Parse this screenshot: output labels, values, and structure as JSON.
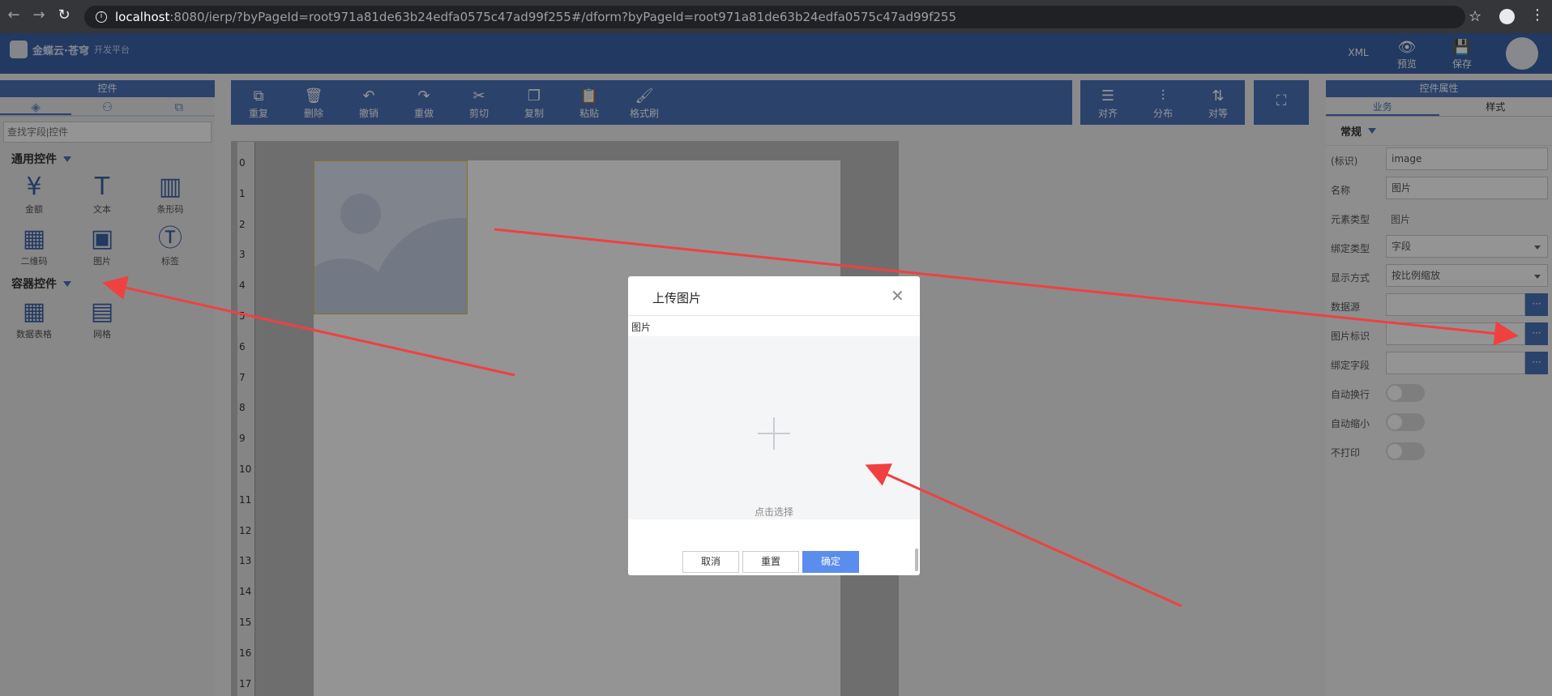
{
  "browser": {
    "url_host": "localhost",
    "url_rest": ":8080/ierp/?byPageId=root971a81de63b24edfa0575c47ad99f255#/dform?byPageId=root971a81de63b24edfa0575c47ad99f255"
  },
  "header": {
    "logo_text": "金蝶云·苍穹",
    "logo_sub": "开发平台",
    "xml_label": "XML",
    "preview_label": "预览",
    "save_label": "保存"
  },
  "left_panel": {
    "title": "控件",
    "search_placeholder": "查找字段|控件",
    "group_common": "通用控件",
    "common_controls": [
      {
        "label": "金额",
        "icon": "yen-icon",
        "glyph": "¥"
      },
      {
        "label": "文本",
        "icon": "text-icon",
        "glyph": "T"
      },
      {
        "label": "条形码",
        "icon": "barcode-icon",
        "glyph": "▥"
      },
      {
        "label": "二维码",
        "icon": "qrcode-icon",
        "glyph": "▦"
      },
      {
        "label": "图片",
        "icon": "image-icon",
        "glyph": "▣"
      },
      {
        "label": "标签",
        "icon": "label-icon",
        "glyph": "Ⓣ"
      }
    ],
    "group_container": "容器控件",
    "container_controls": [
      {
        "label": "数据表格",
        "icon": "table-icon",
        "glyph": "▦"
      },
      {
        "label": "网格",
        "icon": "grid-icon",
        "glyph": "▤"
      }
    ]
  },
  "toolbar": {
    "buttons": [
      {
        "label": "重复",
        "icon": "duplicate-icon",
        "glyph": "⧉"
      },
      {
        "label": "删除",
        "icon": "trash-icon",
        "glyph": "🗑"
      },
      {
        "label": "撤销",
        "icon": "undo-icon",
        "glyph": "↶"
      },
      {
        "label": "重做",
        "icon": "redo-icon",
        "glyph": "↷"
      },
      {
        "label": "剪切",
        "icon": "cut-icon",
        "glyph": "✂"
      },
      {
        "label": "复制",
        "icon": "copy-icon",
        "glyph": "❐"
      },
      {
        "label": "粘贴",
        "icon": "paste-icon",
        "glyph": "📋"
      },
      {
        "label": "格式刷",
        "icon": "format-brush-icon",
        "glyph": "🖌"
      }
    ],
    "align_buttons": [
      {
        "label": "对齐",
        "icon": "align-icon",
        "glyph": "☰"
      },
      {
        "label": "分布",
        "icon": "distribute-icon",
        "glyph": "⫶"
      },
      {
        "label": "对等",
        "icon": "equal-size-icon",
        "glyph": "⇅"
      }
    ],
    "fullscreen_icon": "fullscreen-icon"
  },
  "ruler": {
    "numbers": [
      "0",
      "1",
      "2",
      "3",
      "4",
      "5",
      "6",
      "7",
      "8",
      "9",
      "10",
      "11",
      "12",
      "13",
      "14",
      "15",
      "16",
      "17"
    ]
  },
  "right_panel": {
    "title": "控件属性",
    "tab_business": "业务",
    "tab_style": "样式",
    "section_general": "常规",
    "props": {
      "id_label": "(标识)",
      "id_value": "image",
      "name_label": "名称",
      "name_value": "图片",
      "elem_type_label": "元素类型",
      "elem_type_value": "图片",
      "bind_type_label": "绑定类型",
      "bind_type_value": "字段",
      "display_label": "显示方式",
      "display_value": "按比例缩放",
      "datasource_label": "数据源",
      "image_id_label": "图片标识",
      "bind_field_label": "绑定字段",
      "auto_wrap_label": "自动换行",
      "auto_shrink_label": "自动缩小",
      "no_print_label": "不打印",
      "dots": "···"
    }
  },
  "modal": {
    "title": "上传图片",
    "field_label": "图片",
    "upload_hint": "点击选择",
    "cancel": "取消",
    "reset": "重置",
    "ok": "确定"
  },
  "colors": {
    "header_blue": "#3c63a7",
    "toolbar_blue": "#4a72b8",
    "primary_button": "#5b8def",
    "annotation_arrow": "#f04040"
  }
}
